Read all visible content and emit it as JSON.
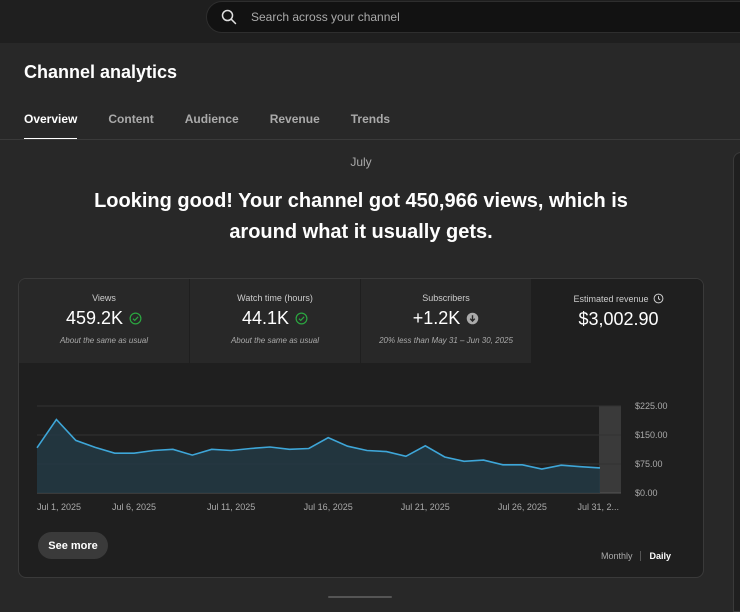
{
  "search": {
    "placeholder": "Search across your channel"
  },
  "page": {
    "title": "Channel analytics"
  },
  "tabs": [
    {
      "label": "Overview",
      "active": true
    },
    {
      "label": "Content",
      "active": false
    },
    {
      "label": "Audience",
      "active": false
    },
    {
      "label": "Revenue",
      "active": false
    },
    {
      "label": "Trends",
      "active": false
    }
  ],
  "summary": {
    "period": "July",
    "headline": "Looking good! Your channel got 450,966 views, which is around what it usually gets."
  },
  "metrics": [
    {
      "label": "Views",
      "value": "459.2K",
      "note": "About the same as usual",
      "status_icon": "check-circle-icon"
    },
    {
      "label": "Watch time (hours)",
      "value": "44.1K",
      "note": "About the same as usual",
      "status_icon": "check-circle-icon"
    },
    {
      "label": "Subscribers",
      "value": "+1.2K",
      "note": "20% less than May 31 – Jun 30, 2025",
      "status_icon": "arrow-down-circle-icon"
    },
    {
      "label": "Estimated revenue",
      "value": "$3,002.90",
      "note": "",
      "label_icon": "clock-icon"
    }
  ],
  "chart_data": {
    "type": "area",
    "series": [
      {
        "values": [
          117,
          190,
          136,
          118,
          103,
          103,
          110,
          113,
          98,
          113,
          110,
          115,
          119,
          113,
          115,
          143,
          121,
          110,
          107,
          95,
          122,
          93,
          82,
          85,
          73,
          73,
          62,
          72,
          68,
          65
        ]
      }
    ],
    "x": [
      "Jul 1, 2025",
      "Jul 2, 2025",
      "Jul 3, 2025",
      "Jul 4, 2025",
      "Jul 5, 2025",
      "Jul 6, 2025",
      "Jul 7, 2025",
      "Jul 8, 2025",
      "Jul 9, 2025",
      "Jul 10, 2025",
      "Jul 11, 2025",
      "Jul 12, 2025",
      "Jul 13, 2025",
      "Jul 14, 2025",
      "Jul 15, 2025",
      "Jul 16, 2025",
      "Jul 17, 2025",
      "Jul 18, 2025",
      "Jul 19, 2025",
      "Jul 20, 2025",
      "Jul 21, 2025",
      "Jul 22, 2025",
      "Jul 23, 2025",
      "Jul 24, 2025",
      "Jul 25, 2025",
      "Jul 26, 2025",
      "Jul 27, 2025",
      "Jul 28, 2025",
      "Jul 29, 2025",
      "Jul 30, 2025"
    ],
    "x_tick_labels": [
      "Jul 1, 2025",
      "Jul 6, 2025",
      "Jul 11, 2025",
      "Jul 16, 2025",
      "Jul 21, 2025",
      "Jul 26, 2025",
      "Jul 31, 2..."
    ],
    "y_tick_labels": [
      "$225.00",
      "$150.00",
      "$75.00",
      "$0.00"
    ],
    "ylim": [
      0,
      225
    ],
    "grid": true,
    "line_color": "#3ea6d8",
    "fill_color": "#233a44"
  },
  "chart": {
    "see_more": "See more",
    "granularity": [
      "Monthly",
      "Daily"
    ],
    "selected": "Daily"
  }
}
